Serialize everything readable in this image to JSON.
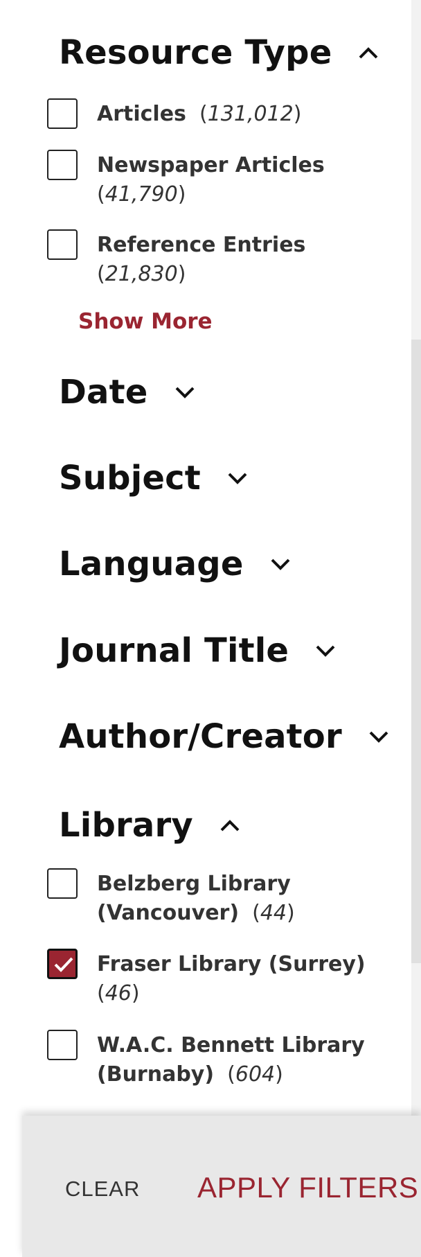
{
  "resource_type": {
    "title": "Resource Type",
    "expanded": true,
    "options": [
      {
        "name": "Articles",
        "count": "131,012",
        "checked": false
      },
      {
        "name": "Newspaper Articles",
        "count": "41,790",
        "checked": false
      },
      {
        "name": "Reference Entries",
        "count": "21,830",
        "checked": false
      }
    ],
    "show_more": "Show More"
  },
  "facets": [
    {
      "title": "Date",
      "expanded": false
    },
    {
      "title": "Subject",
      "expanded": false
    },
    {
      "title": "Language",
      "expanded": false
    },
    {
      "title": "Journal Title",
      "expanded": false
    },
    {
      "title": "Author/Creator",
      "expanded": false
    }
  ],
  "library": {
    "title": "Library",
    "expanded": true,
    "options": [
      {
        "name": "Belzberg Library (Vancouver)",
        "count": "44",
        "checked": false
      },
      {
        "name": "Fraser Library (Surrey)",
        "count": "46",
        "checked": true
      },
      {
        "name": "W.A.C. Bennett Library (Burnaby)",
        "count": "604",
        "checked": false
      }
    ]
  },
  "footer": {
    "clear_label": "CLEAR",
    "apply_label": "APPLY FILTERS"
  },
  "colors": {
    "accent": "#9a2531",
    "footer_bg": "#e8e8e8"
  }
}
